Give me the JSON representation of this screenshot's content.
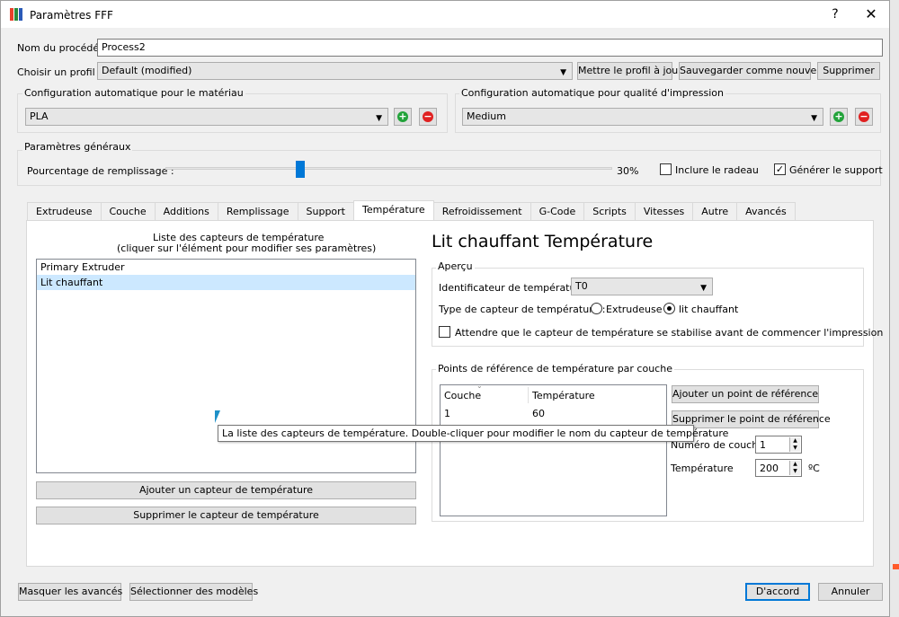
{
  "window": {
    "title": "Paramètres FFF",
    "help": "?",
    "close": "✕"
  },
  "process": {
    "label": "Nom du procédé :",
    "value": "Process2"
  },
  "profile": {
    "label": "Choisir un profil :",
    "selected": "Default (modified)",
    "update_btn": "Mettre le profil à jour",
    "save_new_btn": "Sauvegarder comme nouveau",
    "delete_btn": "Supprimer"
  },
  "auto_material": {
    "title": "Configuration automatique pour le matériau",
    "selected": "PLA"
  },
  "auto_quality": {
    "title": "Configuration automatique pour qualité d'impression",
    "selected": "Medium"
  },
  "general": {
    "title": "Paramètres généraux",
    "infill_label": "Pourcentage de remplissage :",
    "infill_value": "30%",
    "raft_label": "Inclure le radeau",
    "raft_checked": false,
    "support_label": "Générer le support",
    "support_checked": true
  },
  "tabs": [
    "Extrudeuse",
    "Couche",
    "Additions",
    "Remplissage",
    "Support",
    "Température",
    "Refroidissement",
    "G-Code",
    "Scripts",
    "Vitesses",
    "Autre",
    "Avancés"
  ],
  "active_tab": "Température",
  "sensors": {
    "header_line1": "Liste des capteurs de température",
    "header_line2": "(cliquer sur l'élément pour modifier ses paramètres)",
    "items": [
      "Primary Extruder",
      "Lit chauffant"
    ],
    "selected_index": 1,
    "add_btn": "Ajouter un capteur de température",
    "remove_btn": "Supprimer le capteur de température"
  },
  "detail": {
    "heading": "Lit chauffant Température",
    "overview_title": "Aperçu",
    "id_label": "Identificateur de température",
    "id_value": "T0",
    "type_label": "Type de capteur de température :",
    "type_extruder": "Extrudeuse",
    "type_bed": "lit chauffant",
    "wait_label": "Attendre que le capteur de température se stabilise avant de commencer l'impression",
    "wait_checked": false
  },
  "setpoints": {
    "title": "Points de référence de température par couche",
    "col_layer": "Couche",
    "col_temp": "Température",
    "rows": [
      {
        "layer": "1",
        "temp": "60"
      }
    ],
    "add_btn": "Ajouter un point de référence",
    "remove_btn": "Supprimer le point de référence",
    "layer_label": "Numéro de couche",
    "layer_value": "1",
    "temp_label": "Température",
    "temp_value": "200",
    "temp_unit": "ºC"
  },
  "tooltip": "La liste des capteurs de température. Double-cliquer pour modifier le nom du capteur de température",
  "footer": {
    "hide_advanced": "Masquer les avancés",
    "select_models": "Sélectionner des modèles",
    "ok": "D'accord",
    "cancel": "Annuler"
  },
  "colors": {
    "accent": "#0078d7",
    "add_green": "#22a33a",
    "remove_red": "#e02020",
    "selection": "#cce8ff"
  }
}
